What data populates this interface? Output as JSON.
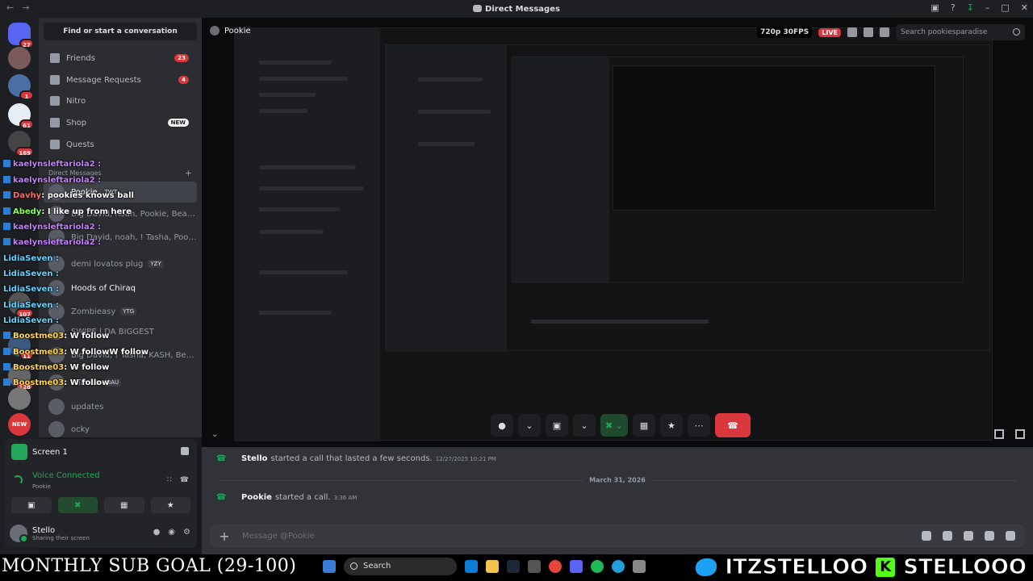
{
  "window": {
    "title": "Direct Messages"
  },
  "rail": {
    "badges": [
      "27",
      "1",
      "61",
      "169",
      "107",
      "11",
      "128"
    ],
    "new_label": "NEW"
  },
  "sidebar": {
    "find_label": "Find or start a conversation",
    "nav": [
      {
        "label": "Friends",
        "count": "23"
      },
      {
        "label": "Message Requests",
        "count": "4"
      },
      {
        "label": "Nitro"
      },
      {
        "label": "Shop",
        "tag": "NEW"
      },
      {
        "label": "Quests"
      }
    ],
    "dm_header": "Direct Messages",
    "dms": [
      {
        "name": "Pookie",
        "tag": "TWT"
      },
      {
        "name": "Big David, noah, Pookie, Beanie..."
      },
      {
        "name": "Big David, noah, ! Tasha, Pookie..."
      },
      {
        "name": "demi lovatos plug",
        "tag": "YZY"
      },
      {
        "name": "Hoods of Chiraq"
      },
      {
        "name": "Zombieasy",
        "tag": "YTG"
      },
      {
        "name": "SWIPE | DA BIGGEST"
      },
      {
        "name": "Big David, ! Tasha, KASH, Beani..."
      },
      {
        "name": "! Tasha",
        "tag": "BAU"
      },
      {
        "name": "updates"
      },
      {
        "name": "ocky"
      }
    ]
  },
  "overlay": [
    {
      "user": "kaelynsleftariola2 :",
      "msg": "",
      "color": "purple"
    },
    {
      "user": "kaelynsleftariola2 :",
      "msg": "",
      "color": "purple"
    },
    {
      "user": "Davhy",
      "msg": ": pookies knows ball",
      "color": "red"
    },
    {
      "user": "Abedy",
      "msg": ": I like up from here",
      "color": "green"
    },
    {
      "user": "kaelynsleftariola2 :",
      "msg": "",
      "color": "purple"
    },
    {
      "user": "kaelynsleftariola2 :",
      "msg": "",
      "color": "purple"
    },
    {
      "user": "LidiaSeven :",
      "msg": "",
      "color": "cyan"
    },
    {
      "user": "LidiaSeven :",
      "msg": "",
      "color": "cyan"
    },
    {
      "user": "LidiaSeven :",
      "msg": "",
      "color": "cyan"
    },
    {
      "user": "LidiaSeven :",
      "msg": "",
      "color": "cyan"
    },
    {
      "user": "LidiaSeven :",
      "msg": "",
      "color": "cyan"
    },
    {
      "user": "Boostme03",
      "msg": ": W follow",
      "color": "yellow"
    },
    {
      "user": "Boostme03",
      "msg": ": W followW follow",
      "color": "yellow"
    },
    {
      "user": "Boostme03",
      "msg": ": W follow",
      "color": "yellow"
    },
    {
      "user": "Boostme03",
      "msg": ": W follow",
      "color": "yellow"
    }
  ],
  "call_panel": {
    "screen_label": "Screen 1",
    "voice_status": "Voice Connected",
    "voice_channel": "Pookie",
    "user_name": "Stello",
    "user_status": "Sharing their screen"
  },
  "stage": {
    "channel": "Pookie",
    "quality": "720p 30FPS",
    "live_label": "LIVE",
    "search_placeholder": "Search pookiesparadise"
  },
  "messages": [
    {
      "user": "Stello",
      "text": "started a call that lasted a few seconds.",
      "time": "12/27/2025 10:21 PM"
    },
    {
      "user": "Pookie",
      "text": "started a call.",
      "time": "3:36 AM"
    }
  ],
  "date_divider": "March 31, 2026",
  "composer": {
    "placeholder": "Message @Pookie"
  },
  "stream_overlay": {
    "sub_goal": "MONTHLY SUB GOAL (29-100)",
    "twitter": "ITZSTELLOO",
    "kick": "STELLOOO",
    "search_label": "Search"
  }
}
